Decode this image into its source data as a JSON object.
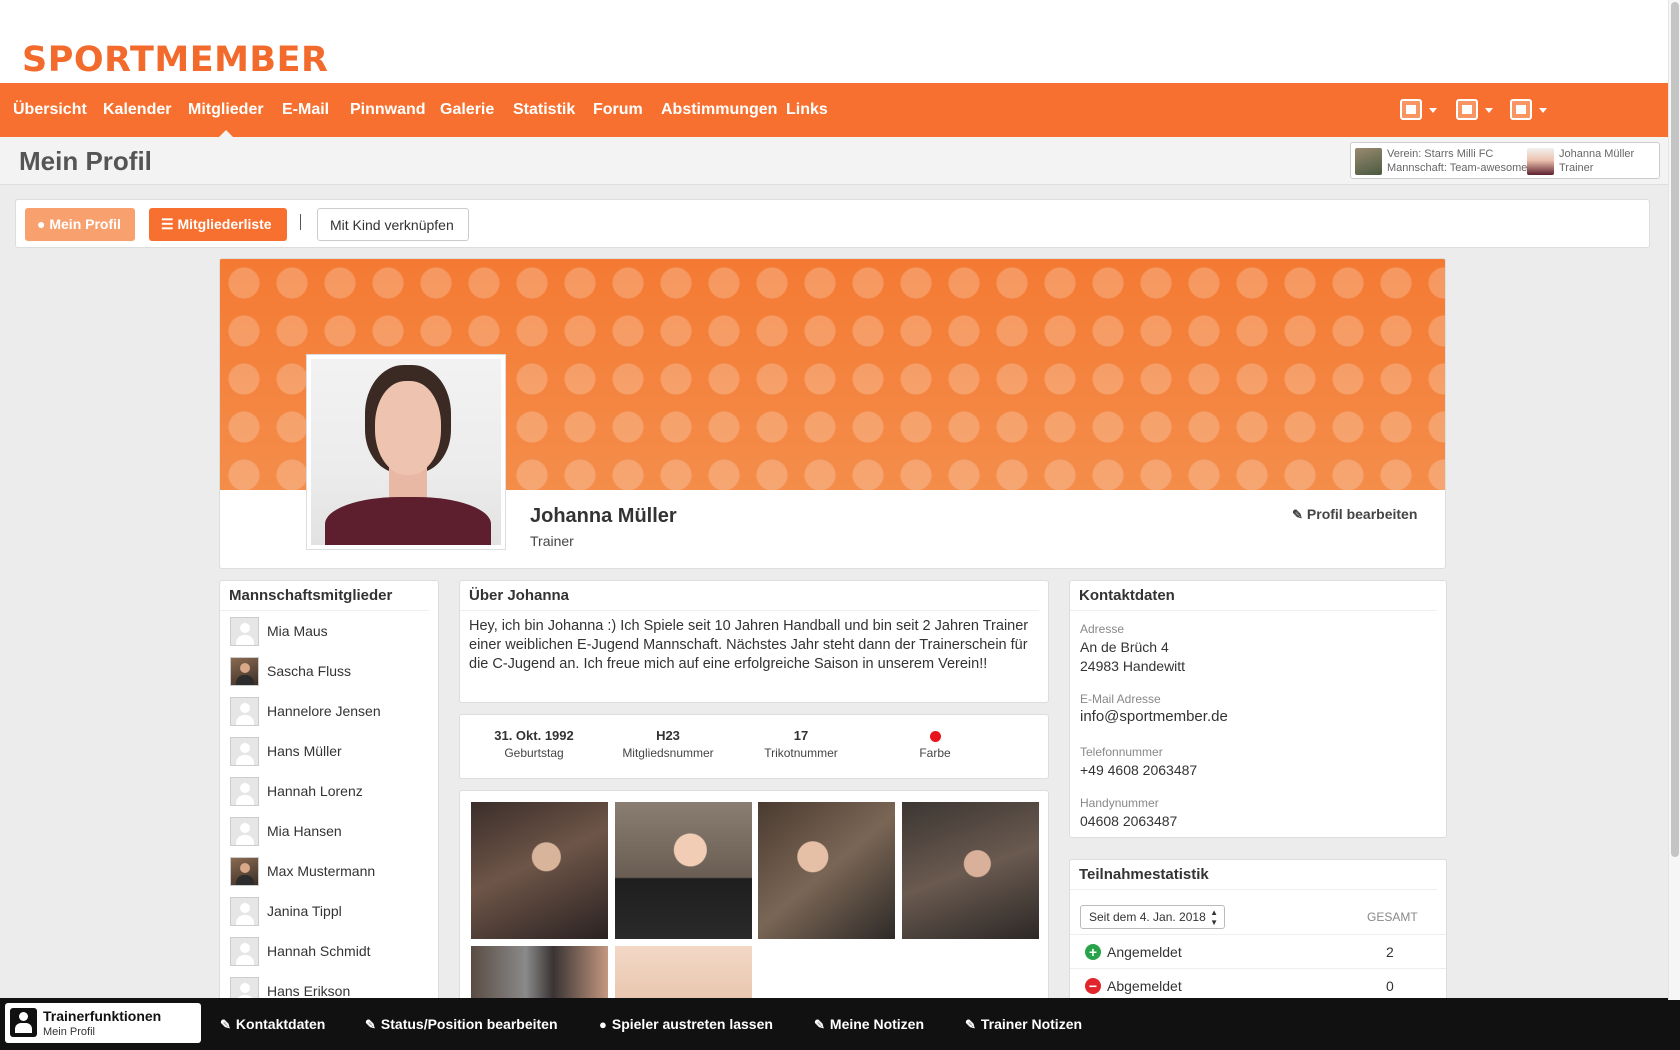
{
  "logo": {
    "text": "SPORTMEMBER"
  },
  "nav": {
    "items": [
      "Übersicht",
      "Kalender",
      "Mitglieder",
      "E-Mail",
      "Pinnwand",
      "Galerie",
      "Statistik",
      "Forum",
      "Abstimmungen",
      "Links"
    ],
    "active": "Mitglieder",
    "right_icons": [
      "home-icon",
      "group-icon",
      "user-icon"
    ]
  },
  "header": {
    "title": "Mein Profil",
    "club_line1": "Verein: Starrs Milli FC",
    "club_line2": "Mannschaft: Team-awesome",
    "user_line1": "Johanna Müller",
    "user_line2": "Trainer"
  },
  "toolbar": {
    "my_profile": "Mein Profil",
    "member_list": "Mitgliederliste",
    "link_child": "Mit Kind verknüpfen"
  },
  "profile": {
    "name": "Johanna Müller",
    "role": "Trainer",
    "edit_label": "Profil bearbeiten"
  },
  "members": {
    "title": "Mannschaftsmitglieder",
    "items": [
      {
        "name": "Mia Maus",
        "photo": false
      },
      {
        "name": "Sascha Fluss",
        "photo": true
      },
      {
        "name": "Hannelore Jensen",
        "photo": false
      },
      {
        "name": "Hans Müller",
        "photo": false
      },
      {
        "name": "Hannah Lorenz",
        "photo": false
      },
      {
        "name": "Mia Hansen",
        "photo": false
      },
      {
        "name": "Max Mustermann",
        "photo": true
      },
      {
        "name": "Janina Tippl",
        "photo": false
      },
      {
        "name": "Hannah Schmidt",
        "photo": false
      },
      {
        "name": "Hans Erikson",
        "photo": false
      }
    ]
  },
  "about": {
    "title": "Über Johanna",
    "text": "Hey, ich bin Johanna :) Ich Spiele seit 10 Jahren Handball und bin seit 2 Jahren Trainer einer weiblichen E-Jugend Mannschaft. Nächstes Jahr steht dann der Trainerschein für die C-Jugend an. Ich freue mich auf eine erfolgreiche Saison in unserem Verein!!"
  },
  "stats": {
    "birthday_value": "31. Okt. 1992",
    "birthday_label": "Geburtstag",
    "member_no_value": "H23",
    "member_no_label": "Mitgliedsnummer",
    "shirt_value": "17",
    "shirt_label": "Trikotnummer",
    "color_label": "Farbe",
    "color_value": "#e8141c"
  },
  "contact": {
    "title": "Kontaktdaten",
    "address_label": "Adresse",
    "address_line1": "An de Brüch 4",
    "address_line2": "24983 Handewitt",
    "email_label": "E-Mail Adresse",
    "email": "info@sportmember.de",
    "phone_label": "Telefonnummer",
    "phone": "+49 4608 2063487",
    "mobile_label": "Handynummer",
    "mobile": "04608 2063487"
  },
  "attendance": {
    "title": "Teilnahmestatistik",
    "period": "Seit dem 4. Jan. 2018",
    "total_label": "GESAMT",
    "rows": [
      {
        "label": "Angemeldet",
        "count": "2",
        "color": "#2aa24a",
        "symbol": "+"
      },
      {
        "label": "Abgemeldet",
        "count": "0",
        "color": "#e0262c",
        "symbol": "−"
      }
    ]
  },
  "bottombar": {
    "trainer_title": "Trainerfunktionen",
    "trainer_sub": "Mein Profil",
    "contact": "Kontaktdaten",
    "status": "Status/Position bearbeiten",
    "leave": "Spieler austreten lassen",
    "my_notes": "Meine Notizen",
    "trainer_notes": "Trainer Notizen"
  },
  "colors": {
    "brand_orange": "#f7702f",
    "light_orange": "#f8a06e",
    "dark_bar": "#111111"
  }
}
